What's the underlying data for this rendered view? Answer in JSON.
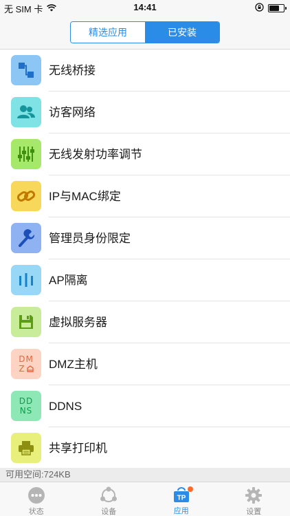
{
  "status_bar": {
    "carrier": "无 SIM 卡",
    "time": "14:41",
    "battery_level": 0.75
  },
  "segmented": {
    "tabs": [
      {
        "label": "精选应用",
        "active": false
      },
      {
        "label": "已安装",
        "active": true
      }
    ]
  },
  "apps": [
    {
      "label": "无线桥接",
      "icon": "bridge-icon",
      "color": "#8cc6f5"
    },
    {
      "label": "访客网络",
      "icon": "guest-users-icon",
      "color": "#7fe3e6"
    },
    {
      "label": "无线发射功率调节",
      "icon": "sliders-icon",
      "color": "#a6e86a"
    },
    {
      "label": "IP与MAC绑定",
      "icon": "link-icon",
      "color": "#f8d85a"
    },
    {
      "label": "管理员身份限定",
      "icon": "wrench-icon",
      "color": "#8fb2f2"
    },
    {
      "label": "AP隔离",
      "icon": "isolation-icon",
      "color": "#98d7f6"
    },
    {
      "label": "虚拟服务器",
      "icon": "floppy-icon",
      "color": "#c9ec9a",
      "icon_text": ""
    },
    {
      "label": "DMZ主机",
      "icon": "dmz-icon",
      "color": "#fdd3c3",
      "icon_text": "DM Z⌂"
    },
    {
      "label": "DDNS",
      "icon": "ddns-icon",
      "color": "#8ee8b6",
      "icon_text": "DD NS"
    },
    {
      "label": "共享打印机",
      "icon": "printer-icon",
      "color": "#e8ef7a"
    }
  ],
  "dmz_icon": {
    "line1": "DM",
    "line2": "Z"
  },
  "ddns_icon": {
    "line1": "DD",
    "line2": "NS"
  },
  "free_space": "可用空间:724KB",
  "tabbar": {
    "tabs": [
      {
        "label": "状态",
        "icon": "status-dots-icon",
        "active": false
      },
      {
        "label": "设备",
        "icon": "devices-icon",
        "active": false
      },
      {
        "label": "应用",
        "icon": "tp-apps-icon",
        "active": true
      },
      {
        "label": "设置",
        "icon": "gear-icon",
        "active": false
      }
    ]
  },
  "colors": {
    "accent": "#2b8ce8",
    "badge": "#ff6a2a"
  }
}
